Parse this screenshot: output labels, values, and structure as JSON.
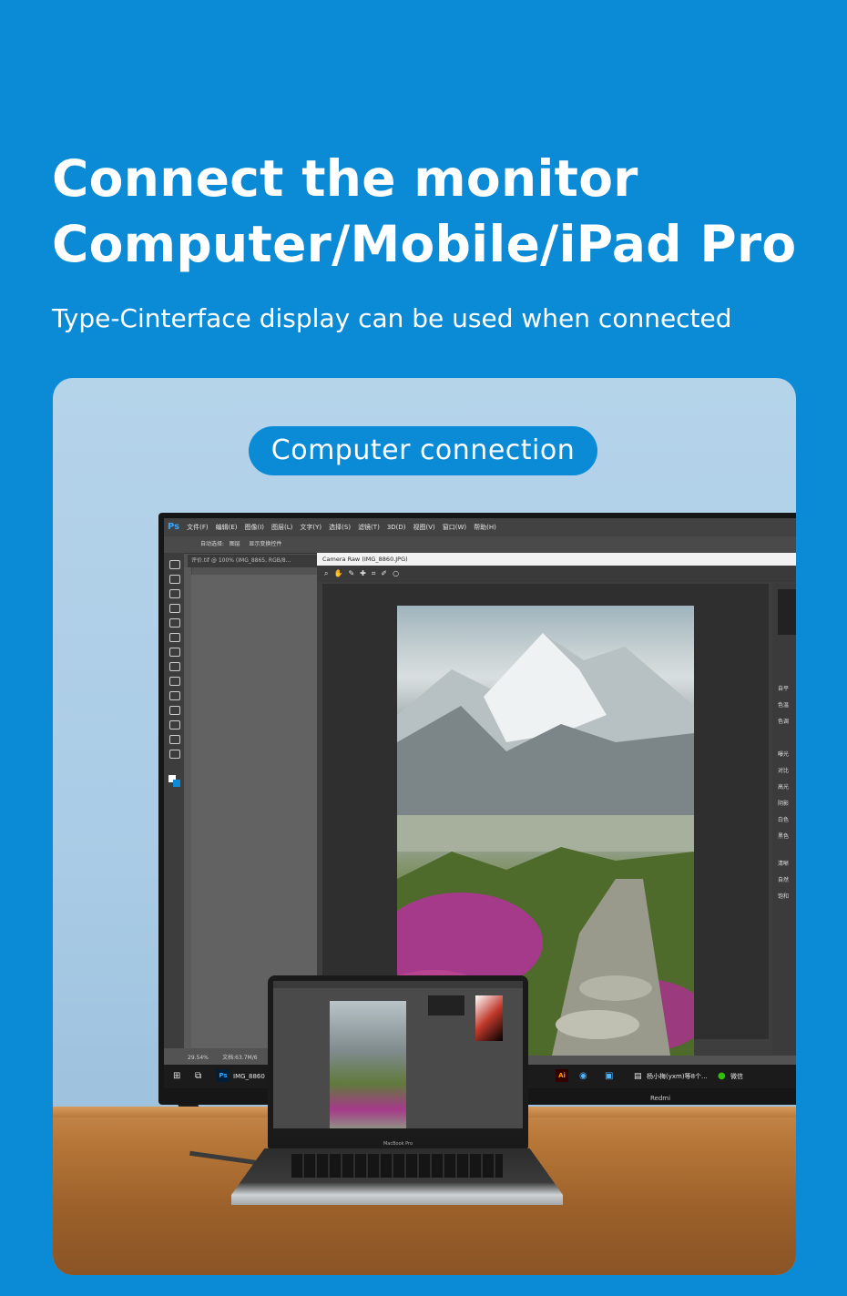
{
  "header": {
    "title_line1": "Connect the monitor",
    "title_line2": "Computer/Mobile/iPad Pro",
    "subtitle": "Type-Cinterface display can be used when connected"
  },
  "badge": {
    "label": "Computer connection"
  },
  "monitor": {
    "brand": "Redmi",
    "app": {
      "logo": "Ps",
      "menu": [
        "文件(F)",
        "编辑(E)",
        "图像(I)",
        "图层(L)",
        "文字(Y)",
        "选择(S)",
        "滤镜(T)",
        "3D(D)",
        "视图(V)",
        "窗口(W)",
        "帮助(H)"
      ],
      "options": [
        "自动选择:",
        "图层",
        "显示变换控件"
      ],
      "doc_tab": "评价.tif @ 100% (IMG_8865, RGB/8...",
      "zoom": "29.54%",
      "doc_size": "文档:63.7M/6",
      "camera_raw_title": "Camera Raw (IMG_8860.JPG)",
      "panel_labels": [
        "自平",
        "色温",
        "色调",
        "曝光",
        "对比",
        "高光",
        "阴影",
        "白色",
        "黑色",
        "清晰",
        "自然",
        "饱和"
      ]
    },
    "taskbar": {
      "ps_item": "IMG_8860",
      "wechat": "微信",
      "chat_item": "杨小梅(yxm)等8个..."
    }
  },
  "laptop": {
    "brand": "MacBook Pro"
  },
  "colors": {
    "background": "#0b8ad6",
    "pill": "#0b8ad6",
    "text": "#ffffff"
  }
}
